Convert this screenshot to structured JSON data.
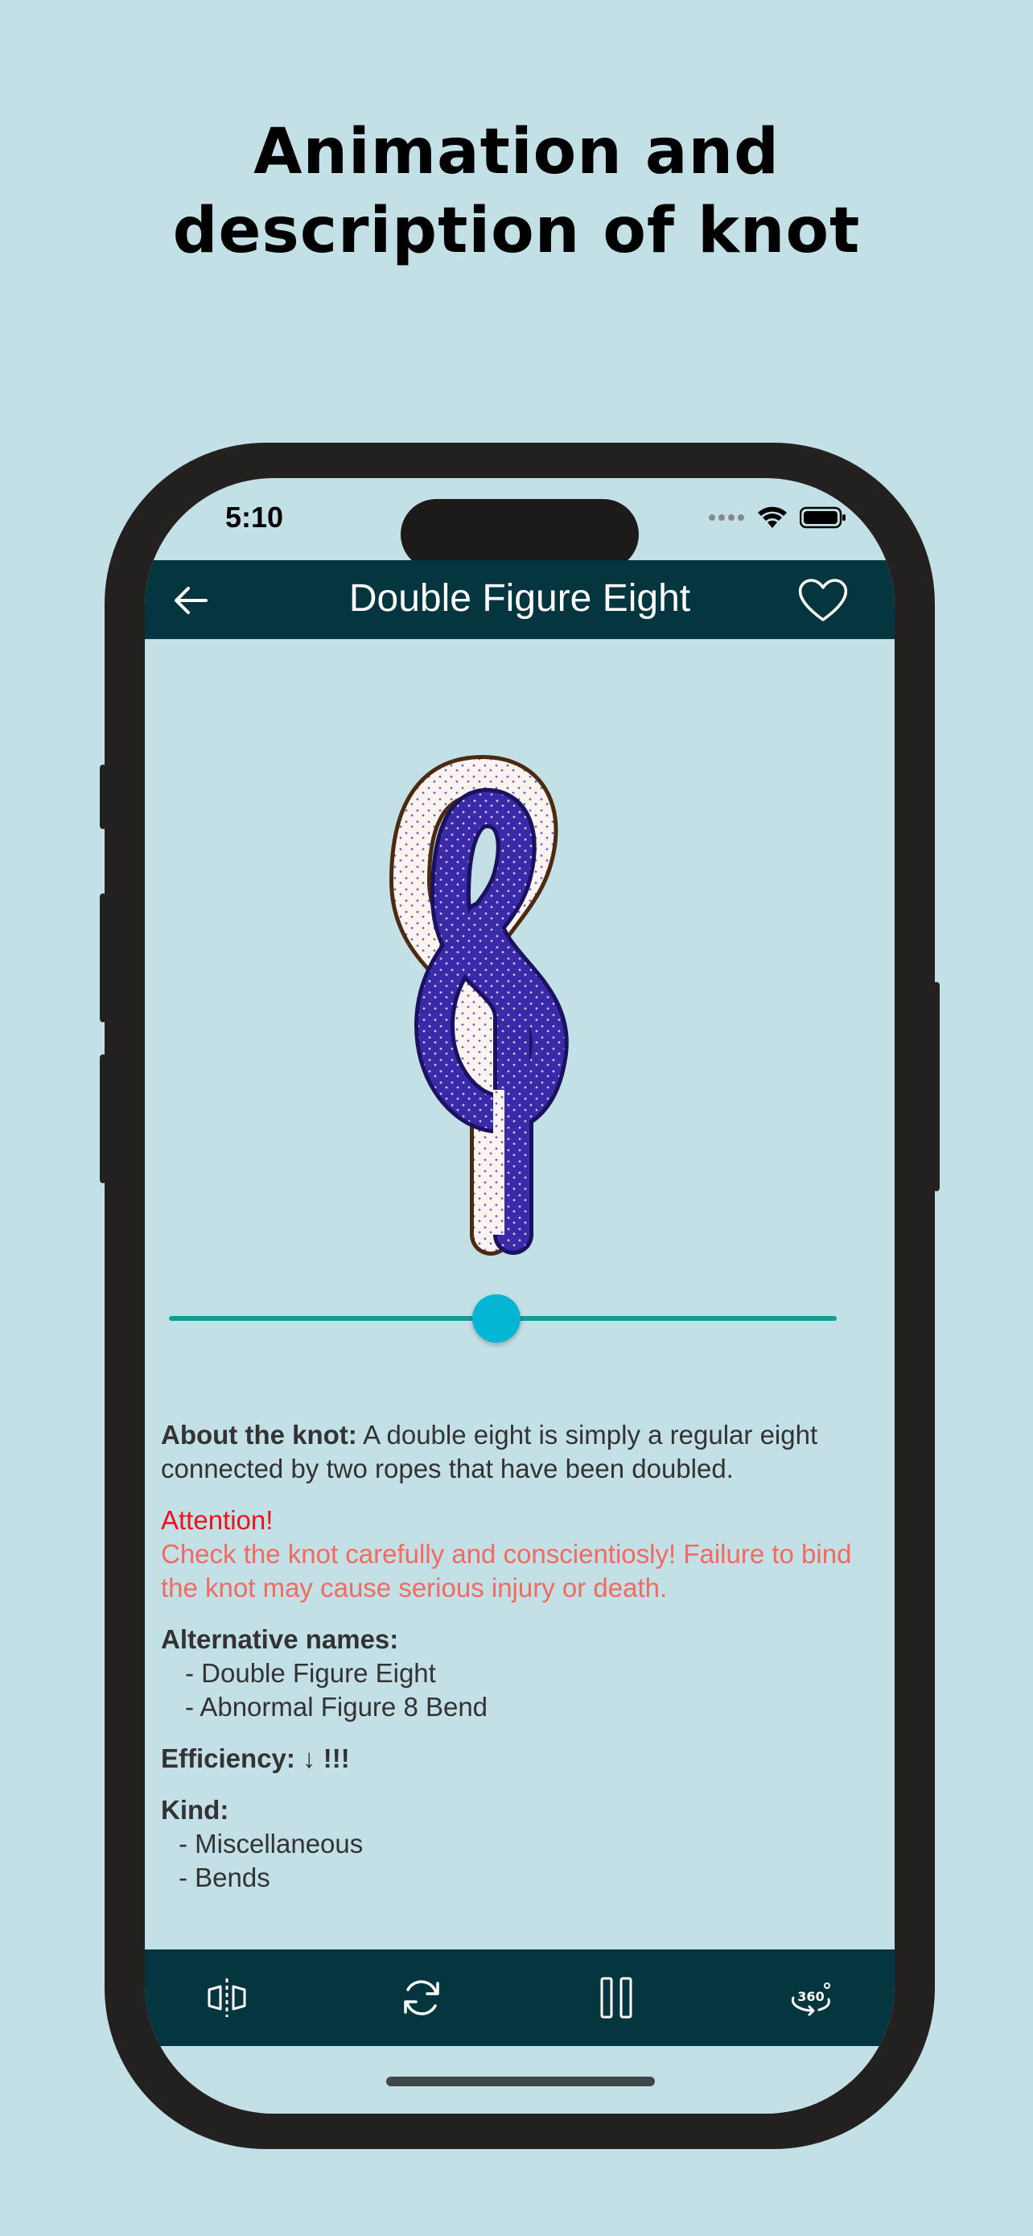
{
  "promo": {
    "title_line1": "Animation and",
    "title_line2": "description of knot"
  },
  "status_bar": {
    "time": "5:10"
  },
  "appbar": {
    "title": "Double Figure Eight"
  },
  "player": {
    "progress": 0.49
  },
  "about": {
    "label": "About the knot:",
    "text": " A double eight is simply a regular eight connected by two ropes that have been doubled."
  },
  "attention": {
    "title": "Attention!",
    "text": "Check the knot carefully and conscientiosly! Failure to bind the knot may cause serious injury or death."
  },
  "alternative_names": {
    "label": "Alternative names:",
    "items": [
      "- Double Figure Eight",
      "- Abnormal Figure 8 Bend"
    ]
  },
  "efficiency": {
    "label": "Efficiency: ↓ !!!"
  },
  "kind": {
    "label": "Kind:",
    "items": [
      "- Miscellaneous",
      "- Bends"
    ]
  },
  "colors": {
    "background": "#c4e0e7",
    "appbar": "#053640",
    "slider_track": "#169a95",
    "slider_thumb": "#05b6d4",
    "attention_title": "#e8151b",
    "attention_text": "#f06b60",
    "rope_blue": "#3a2aa8",
    "rope_white": "#fbf4ee"
  },
  "icons": {
    "back": "arrow-left-icon",
    "favorite": "heart-outline-icon",
    "mirror": "flip-horizontal-icon",
    "repeat": "repeat-icon",
    "pause": "pause-icon",
    "rotate": "rotate-360-icon"
  }
}
